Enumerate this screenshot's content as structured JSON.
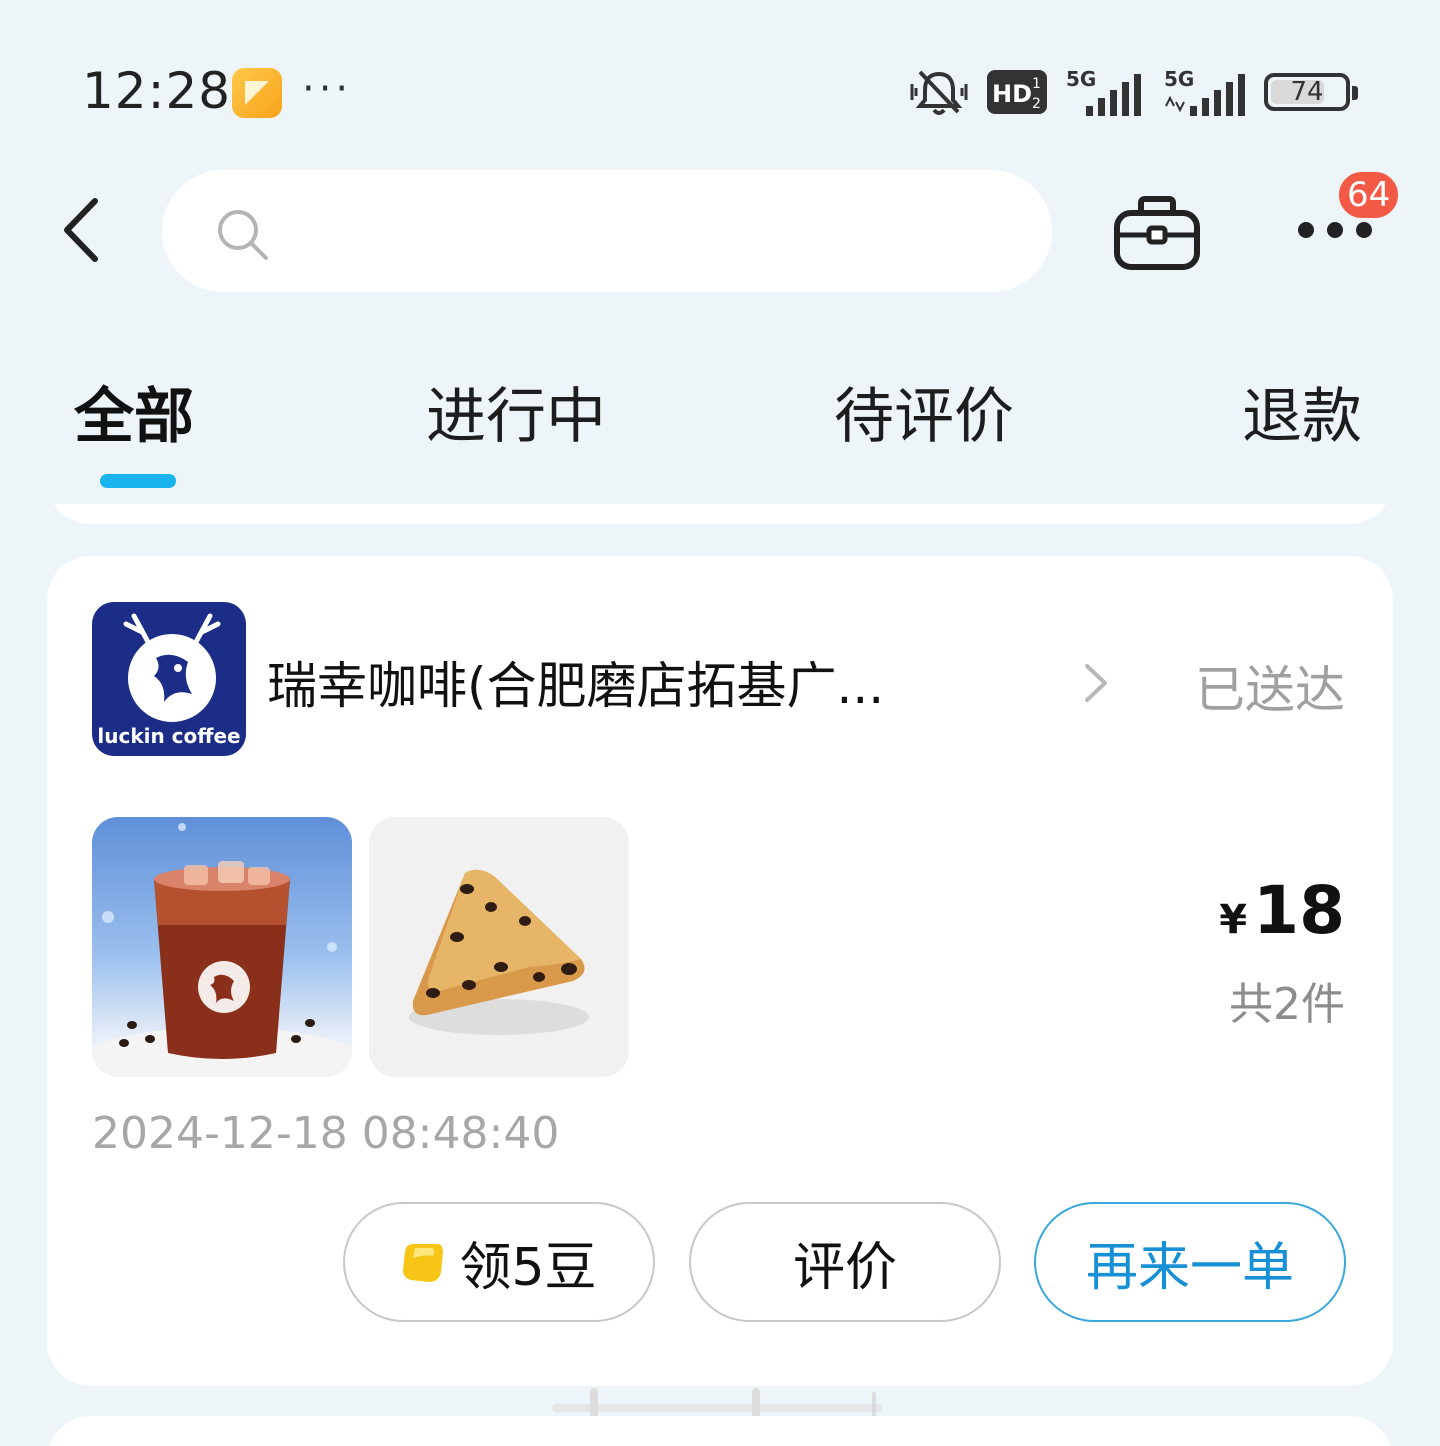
{
  "status_bar": {
    "time": "12:28",
    "more": "···",
    "hd_label": "HD",
    "network_1": "5G",
    "network_2": "5G",
    "battery": "74",
    "battery_level": 0.74
  },
  "top_bar": {
    "search_placeholder": "",
    "notification_badge": "64"
  },
  "tabs": [
    {
      "label": "全部",
      "active": true
    },
    {
      "label": "进行中",
      "active": false
    },
    {
      "label": "待评价",
      "active": false
    },
    {
      "label": "退款",
      "active": false
    }
  ],
  "order": {
    "store_logo_text": "luckin coffee",
    "store_name": "瑞幸咖啡(合肥磨店拓基广...",
    "status": "已送达",
    "currency": "¥",
    "price": "18",
    "item_count": "共2件",
    "time": "2024-12-18 08:48:40",
    "actions": {
      "beans": "领5豆",
      "review": "评价",
      "reorder": "再来一单"
    }
  },
  "colors": {
    "accent": "#19b3ee",
    "reorder": "#1890d6",
    "badge": "#f35a45",
    "brand": "#1b2d86"
  }
}
